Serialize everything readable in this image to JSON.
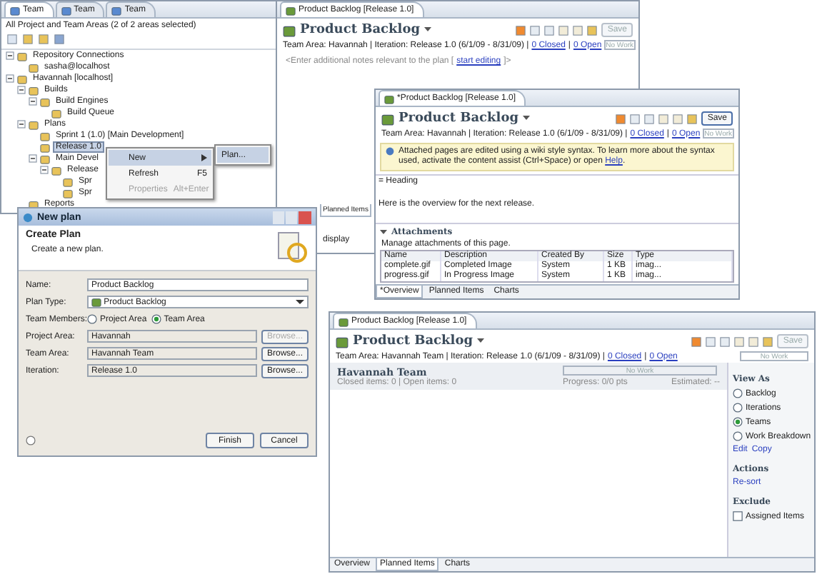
{
  "team_view": {
    "tabs": [
      {
        "label": "Team",
        "selected": true
      },
      {
        "label": "Team",
        "selected": false
      },
      {
        "label": "Team",
        "selected": false
      }
    ],
    "filter": "All Project and Team Areas (2 of 2 areas selected)",
    "tree": [
      {
        "label": "Repository Connections",
        "selected": false,
        "children": [
          {
            "label": "sasha@localhost",
            "selected": false
          }
        ]
      },
      {
        "label": "Havannah [localhost]",
        "selected": false,
        "children": [
          {
            "label": "Builds",
            "selected": false,
            "children": [
              {
                "label": "Build Engines",
                "selected": false,
                "children": [
                  {
                    "label": "Build Queue",
                    "selected": false
                  }
                ]
              }
            ]
          },
          {
            "label": "Plans",
            "selected": false,
            "children": [
              {
                "label": "Sprint 1 (1.0) [Main Development]",
                "selected": false
              },
              {
                "label": "Release 1.0",
                "selected": true
              },
              {
                "label": "Main Devel",
                "selected": false,
                "children": [
                  {
                    "label": "Release",
                    "selected": false,
                    "children": [
                      {
                        "label": "Spr",
                        "selected": false
                      },
                      {
                        "label": "Spr",
                        "selected": false
                      }
                    ]
                  }
                ]
              }
            ]
          },
          {
            "label": "Reports",
            "selected": false
          }
        ]
      }
    ]
  },
  "context_menu": {
    "items": [
      {
        "label": "New",
        "disabled": false,
        "selected": true,
        "kind": "submenu"
      },
      {
        "label": "Refresh",
        "shortcut": "F5",
        "disabled": false,
        "selected": false,
        "kind": "command"
      },
      {
        "label": "Properties",
        "shortcut": "Alt+Enter",
        "disabled": true,
        "selected": false,
        "kind": "command"
      }
    ],
    "submenu": [
      {
        "label": "Plan...",
        "selected": true
      }
    ]
  },
  "editor_top": {
    "tab": "Product Backlog [Release 1.0]",
    "title": "Product Backlog",
    "save": "Save",
    "save_enabled": false,
    "info": "Team Area: Havannah | Iteration: Release 1.0 (6/1/09 - 8/31/09) |",
    "closed": "0 Closed",
    "separator": "|",
    "open": "0 Open",
    "progress": "No Work",
    "notes": {
      "before": "<Enter additional notes relevant to the plan [",
      "link": "start editing",
      "after": "]>"
    },
    "fragments": {
      "tab": "Planned Items",
      "text": "display"
    }
  },
  "editor_attach": {
    "tab": "*Product Backlog [Release 1.0]",
    "title": "Product Backlog",
    "save": "Save",
    "save_enabled": true,
    "info": "Team Area: Havannah | Iteration: Release 1.0 (6/1/09 - 8/31/09) |",
    "closed": "0 Closed",
    "separator": "|",
    "open": "0 Open",
    "progress": "No Work",
    "banner": {
      "text": "Attached pages are edited using a wiki style syntax. To learn more about the syntax used, activate the content assist (Ctrl+Space) or open",
      "link": "Help",
      "end": "."
    },
    "lines": [
      "= Heading",
      "Here is the overview for the next release."
    ],
    "attachments": {
      "title": "Attachments",
      "description": "Manage attachments of this page.",
      "columns": [
        "Name",
        "Description",
        "Created By",
        "Size",
        "Type"
      ],
      "rows": [
        [
          "complete.gif",
          "Completed Image",
          "System",
          "1 KB",
          "imag..."
        ],
        [
          "progress.gif",
          "In Progress Image",
          "System",
          "1 KB",
          "imag..."
        ]
      ]
    },
    "bottom_tabs": [
      {
        "label": "*Overview",
        "selected": true
      },
      {
        "label": "Planned Items",
        "selected": false
      },
      {
        "label": "Charts",
        "selected": false
      }
    ]
  },
  "dialog": {
    "title": "New plan",
    "heading": "Create Plan",
    "subtitle": "Create a new plan.",
    "fields": [
      {
        "kind": "input",
        "label": "Name:",
        "value": "Product Backlog"
      },
      {
        "kind": "select",
        "label": "Plan Type:",
        "value": "Product Backlog"
      },
      {
        "kind": "radios",
        "label": "Team Members:",
        "options": [
          {
            "label": "Project Area",
            "selected": false
          },
          {
            "label": "Team Area",
            "selected": true
          }
        ]
      },
      {
        "kind": "browse",
        "label": "Project Area:",
        "value": "Havannah",
        "button": "Browse...",
        "disabled": true
      },
      {
        "kind": "browse",
        "label": "Team Area:",
        "value": "Havannah Team",
        "button": "Browse...",
        "disabled": false
      },
      {
        "kind": "browse",
        "label": "Iteration:",
        "value": "Release 1.0",
        "button": "Browse...",
        "disabled": false
      }
    ],
    "buttons": [
      "Finish",
      "Cancel"
    ]
  },
  "editor_bottom": {
    "tab": "Product Backlog [Release 1.0]",
    "title": "Product Backlog",
    "save": "Save",
    "save_enabled": false,
    "info": "Team Area: Havannah Team | Iteration: Release 1.0 (6/1/09 - 8/31/09) |",
    "closed": "0 Closed",
    "separator": "|",
    "open": "0 Open",
    "progress": "No Work",
    "group": {
      "name": "Havannah Team",
      "counts": "Closed items: 0 | Open items: 0",
      "bar": "No Work",
      "progress": "Progress: 0/0 pts",
      "estimated": "Estimated: --"
    },
    "view_as": {
      "title": "View As",
      "options": [
        {
          "label": "Backlog",
          "selected": false
        },
        {
          "label": "Iterations",
          "selected": false
        },
        {
          "label": "Teams",
          "selected": true
        },
        {
          "label": "Work Breakdown",
          "selected": false
        }
      ],
      "links": [
        "Edit",
        "Copy"
      ]
    },
    "actions": {
      "title": "Actions",
      "links": [
        "Re-sort"
      ]
    },
    "exclude": {
      "title": "Exclude",
      "options": [
        {
          "label": "Assigned Items",
          "checked": false
        }
      ]
    },
    "bottom_tabs": [
      {
        "label": "Overview",
        "selected": false
      },
      {
        "label": "Planned Items",
        "selected": true
      },
      {
        "label": "Charts",
        "selected": false
      }
    ]
  }
}
